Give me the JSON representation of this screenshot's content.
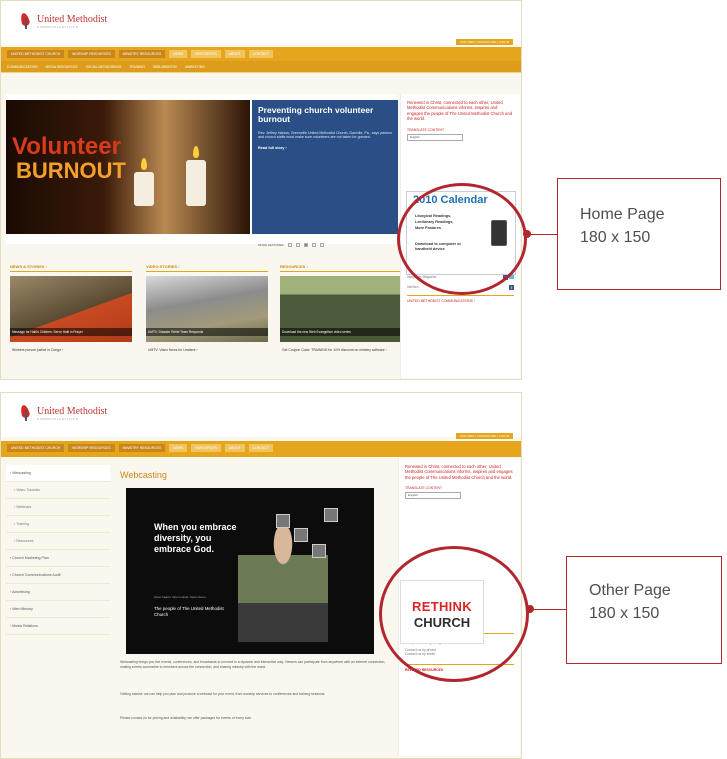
{
  "logo_text": "United Methodist",
  "logo_sub": "COMMUNICATIONS",
  "top_links": "UMC.ORG | UMCOM.ORG | LOG IN",
  "nav_primary": [
    "UNITED METHODIST CHURCH",
    "WORSHIP RESOURCES",
    "MINISTRY RESOURCES",
    "NEWS",
    "RESOURCES",
    "ABOUT",
    "CONTACT"
  ],
  "nav_secondary": [
    "COMMUNICATIONS",
    "MEDIA RESOURCES",
    "SOCIAL NETWORKING",
    "TRAINING",
    "WEB MINISTRY",
    "MARKETING"
  ],
  "home": {
    "hero_title_1": "Volunteer",
    "hero_title_2": "BURNOUT",
    "feature_title": "Preventing church volunteer burnout",
    "feature_body": "Rev. Jeffrey Harlow, Greenville United Methodist Church, Danville, Pa., says pastors and church staffs must make sure volunteers are not taken for granted.",
    "feature_more": "Read full story ›",
    "controls_label": "MORE FEATURES",
    "columns": [
      {
        "heading": "NEWS & STORIES ›",
        "caption": "Message for Haiti's Children: Serve Haiti in Prayer",
        "link": "Workers pursue justice in Congo ›"
      },
      {
        "heading": "VIDEO STORIES ›",
        "caption": "UMTV: Disaster Relief Team Responds",
        "link": "UMTV: Video News for Leaders ›"
      },
      {
        "heading": "RESOURCES ›",
        "caption": "Download the new Web Evangelism video series",
        "link": "Get Coupon Code: TRAINING for 10% discount on ministry software ›"
      }
    ],
    "sidebar_text": "Renewed in Christ, connected to each other, United Methodist Communications informs, inspires and engages the people of The United Methodist Church and the world.",
    "translate_label": "TRANSLATE CONTENT",
    "translate_value": "English",
    "calendar": {
      "title": "2010 Calendar",
      "line1": "Liturgical Readings,",
      "line2": "Lectionary Readings,",
      "line3": "More Features",
      "line4": "Download to computer or handheld device"
    },
    "social_heading": "Social Networking",
    "social": [
      "The United Methodist Church",
      "UM Communications",
      "United Methodist News Service",
      "Interpreter Magazine",
      "InfoServ"
    ],
    "sidebar_footer": "UNITED METHODIST COMMUNICATIONS ›"
  },
  "other": {
    "page_title": "Webcasting",
    "left_nav": [
      {
        "label": "› Webcasting",
        "type": "hl"
      },
      {
        "label": "› Video Tutorials",
        "type": "sub"
      },
      {
        "label": "› Webinars",
        "type": "sub"
      },
      {
        "label": "› Training",
        "type": "sub"
      },
      {
        "label": "› Resources",
        "type": "sub"
      },
      {
        "label": "› Church Marketing Plan",
        "type": ""
      },
      {
        "label": "› Church Communications Audit",
        "type": ""
      },
      {
        "label": "› Advertising",
        "type": ""
      },
      {
        "label": "› Web Ministry",
        "type": ""
      },
      {
        "label": "› Media Relations",
        "type": ""
      }
    ],
    "video_headline": "When you embrace diversity, you embrace God.",
    "video_small": "Open hearts. Open minds. Open doors.",
    "video_people": "The people of The United Methodist Church",
    "paragraph_1": "Webcasting brings you live events, conferences, and broadcasts to connect in a dynamic and interactive way. Viewers can participate from anywhere with an internet connection, making events accessible to members across the connection, and sharing ministry with the world.",
    "paragraph_2": "Getting started: we can help you plan and produce a webcast for your event, from worship services to conferences and training sessions.",
    "paragraph_3": "Please contact us for pricing and availability; we offer packages for events of every size.",
    "sidebar_text": "Renewed in Christ, connected to each other, United Methodist Communications informs, inspires and engages the people of The United Methodist Church and the world.",
    "translate_label": "TRANSLATE CONTENT",
    "translate_value": "English",
    "rethink_1": "RETHINK",
    "rethink_2": "CHURCH",
    "contact_heading": "CONTACT US",
    "contact_text": "For questions regarding this",
    "contact_phone": "Contact us by phone",
    "contact_email": "Contact us by email",
    "related_heading": "RELATED RESOURCES"
  },
  "callouts": {
    "home": {
      "line1": "Home Page",
      "line2": "180 x 150"
    },
    "other": {
      "line1": "Other Page",
      "line2": "180 x 150"
    }
  },
  "colors": {
    "accent": "#e5a51d",
    "callout": "#b2262e",
    "feature_blue": "#2a4f86"
  }
}
